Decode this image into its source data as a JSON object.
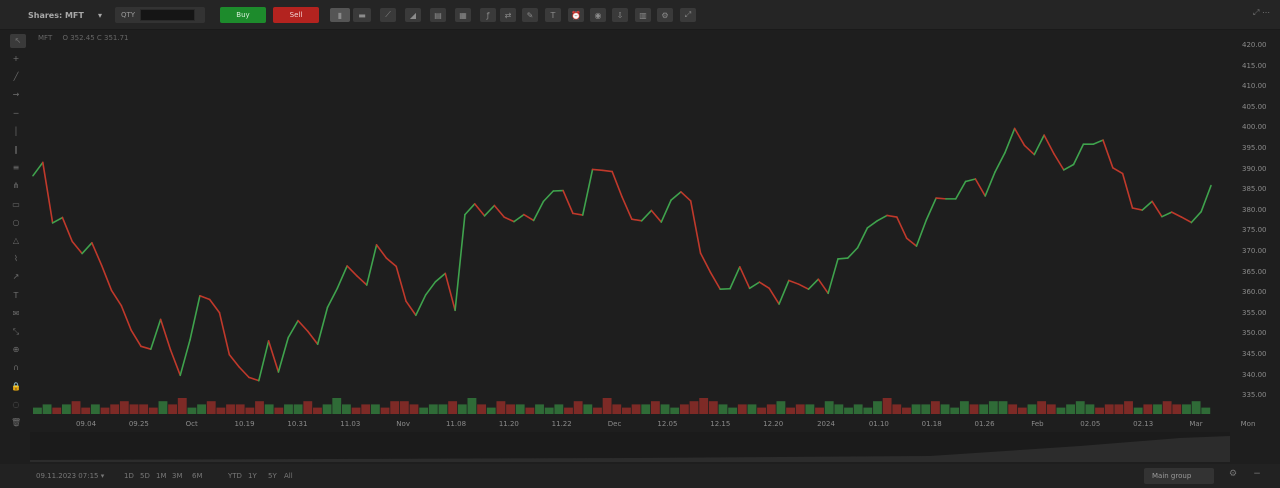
{
  "toolbar": {
    "symbol": "Shares: MFT",
    "symbol_caret": "▾",
    "qty_label": "QTY",
    "buy_label": "Buy",
    "sell_label": "Sell",
    "icons": [
      "candles-icon",
      "bars-icon",
      "line-icon",
      "area-icon",
      "heikin-icon",
      "renko-icon",
      "indicator-icon",
      "compare-icon",
      "draw-icon",
      "text-icon",
      "alert-icon",
      "camera-icon",
      "save-icon",
      "layout-icon",
      "settings-icon",
      "fullscreen-icon"
    ],
    "right_label": "⤢ ⋯"
  },
  "legend": {
    "series": "MFT",
    "values": "O 352.45 C 351.71"
  },
  "left_tools": [
    "cursor-icon",
    "crosshair-icon",
    "trendline-icon",
    "ray-icon",
    "hline-icon",
    "vline-icon",
    "channel-icon",
    "fib-icon",
    "pitchfork-icon",
    "rect-icon",
    "ellipse-icon",
    "triangle-icon",
    "path-icon",
    "arrow-icon",
    "text-tool-icon",
    "note-icon",
    "measure-icon",
    "zoom-icon",
    "magnet-icon",
    "lock-icon",
    "hide-icon",
    "trash-icon"
  ],
  "price_axis": [
    "420.00",
    "415.00",
    "410.00",
    "405.00",
    "400.00",
    "395.00",
    "390.00",
    "385.00",
    "380.00",
    "375.00",
    "370.00",
    "365.00",
    "360.00",
    "355.00",
    "350.00",
    "345.00",
    "340.00",
    "335.00"
  ],
  "time_axis": [
    "09.04",
    "09.25",
    "Oct",
    "10.19",
    "10.31",
    "11.03",
    "Nov",
    "11.08",
    "11.20",
    "11.22",
    "Dec",
    "12.05",
    "12.15",
    "12.20",
    "2024",
    "01.10",
    "01.18",
    "01.26",
    "Feb",
    "02.05",
    "02.13",
    "Mar"
  ],
  "time_axis_right": "Mon",
  "bottom": {
    "range": "09.11.2023 07:15 ▾",
    "periods": [
      "1D",
      "5D",
      "1M",
      "3M",
      "6M",
      "YTD",
      "1Y",
      "5Y",
      "All"
    ],
    "select": "Main group",
    "icons": [
      "settings-icon",
      "zoom-out-icon"
    ]
  },
  "colors": {
    "up": "#3fa34d",
    "down": "#c0392b",
    "bg": "#1e1e1e"
  },
  "chart_data": {
    "type": "line",
    "ylim": [
      335,
      420
    ],
    "values": [
      388.2,
      391.4,
      376.8,
      378.1,
      372.3,
      369.4,
      372.0,
      366.5,
      360.5,
      356.8,
      350.9,
      347.0,
      346.3,
      353.5,
      346.2,
      340.0,
      348.6,
      359.2,
      358.3,
      355.1,
      345.0,
      342.0,
      339.5,
      338.7,
      348.3,
      340.8,
      349.1,
      353.2,
      350.6,
      347.5,
      356.4,
      361.0,
      366.4,
      364.0,
      361.8,
      371.5,
      368.3,
      366.3,
      357.9,
      354.5,
      359.4,
      362.6,
      364.6,
      355.7,
      378.8,
      381.4,
      378.5,
      381.0,
      378.2,
      377.1,
      378.8,
      377.4,
      382.0,
      384.5,
      384.6,
      379.1,
      378.7,
      389.7,
      389.5,
      389.2,
      383.1,
      377.7,
      377.3,
      379.8,
      377.0,
      382.3,
      384.3,
      382.1,
      369.5,
      364.9,
      360.8,
      360.9,
      366.2,
      361.0,
      362.5,
      361.0,
      357.2,
      362.9,
      362.0,
      360.8,
      363.2,
      359.8,
      368.1,
      368.3,
      370.8,
      375.6,
      377.3,
      378.6,
      378.2,
      373.1,
      371.2,
      377.5,
      382.8,
      382.6,
      382.6,
      386.8,
      387.4,
      383.3,
      389.1,
      393.7,
      399.6,
      395.5,
      393.3,
      398.0,
      393.5,
      389.6,
      390.9,
      395.8,
      395.8,
      396.8,
      390.1,
      388.7,
      380.4,
      379.9,
      382.0,
      378.3,
      379.4,
      378.2,
      376.9,
      379.5,
      385.8
    ]
  },
  "volume_data": [
    2,
    3,
    2,
    3,
    4,
    2,
    3,
    2,
    3,
    4,
    3,
    3,
    2,
    4,
    3,
    5,
    2,
    3,
    4,
    2,
    3,
    3,
    2,
    4,
    3,
    2,
    3,
    3,
    4,
    2,
    3,
    5,
    3,
    2,
    3,
    3,
    2,
    4,
    4,
    3,
    2,
    3,
    3,
    4,
    3,
    5,
    3,
    2,
    4,
    3,
    3,
    2,
    3,
    2,
    3,
    2,
    4,
    3,
    2,
    5,
    3,
    2,
    3,
    3,
    4,
    3,
    2,
    3,
    4,
    5,
    4,
    3,
    2,
    3,
    3,
    2,
    3,
    4,
    2,
    3,
    3,
    2,
    4,
    3,
    2,
    3,
    2,
    4,
    5,
    3,
    2,
    3,
    3,
    4,
    3,
    2,
    4,
    3,
    3,
    4,
    4,
    3,
    2,
    3,
    4,
    3,
    2,
    3,
    4,
    3,
    2,
    3,
    3,
    4,
    2,
    3,
    3,
    4,
    3,
    3,
    4,
    2
  ]
}
